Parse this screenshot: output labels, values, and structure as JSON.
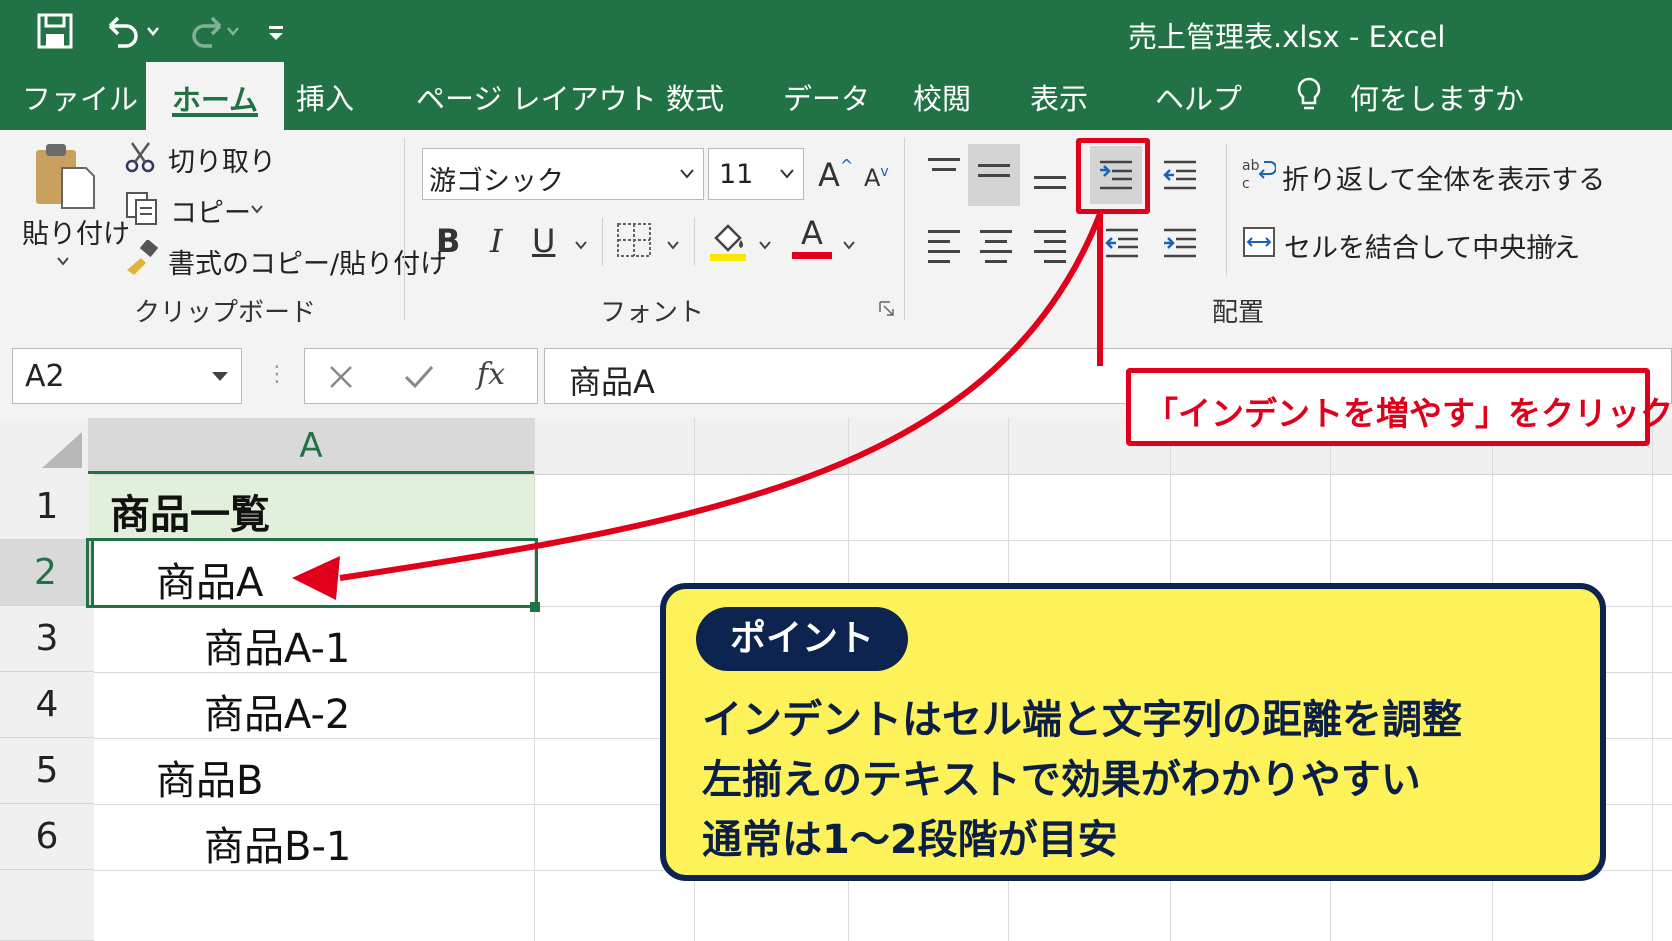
{
  "window": {
    "title": "売上管理表.xlsx  -  Excel"
  },
  "tabs": [
    "ファイル",
    "ホーム",
    "挿入",
    "ページ レイアウト",
    "数式",
    "データ",
    "校閲",
    "表示",
    "ヘルプ"
  ],
  "tell_me": "何をしますか",
  "clipboard": {
    "paste": "貼り付け",
    "cut": "切り取り",
    "copy": "コピー",
    "format_painter": "書式のコピー/貼り付け",
    "group_label": "クリップボード"
  },
  "font": {
    "name": "游ゴシック",
    "size": "11",
    "bold": "B",
    "italic": "I",
    "underline": "U",
    "font_color_letter": "A",
    "grow": "A",
    "shrink": "A",
    "group_label": "フォント",
    "highlight_color": "#f6e600",
    "font_color": "#e0001b"
  },
  "alignment": {
    "wrap_text": "折り返して全体を表示する",
    "merge_center": "セルを結合して中央揃え",
    "group_label": "配置"
  },
  "formula_bar": {
    "name_box": "A2",
    "fx": "fx",
    "content": "商品A"
  },
  "sheet": {
    "column_a_header": "A",
    "rows": [
      {
        "num": "1",
        "value": "商品一覧"
      },
      {
        "num": "2",
        "value": "商品A"
      },
      {
        "num": "3",
        "value": "商品A-1"
      },
      {
        "num": "4",
        "value": "商品A-2"
      },
      {
        "num": "5",
        "value": "商品B"
      },
      {
        "num": "6",
        "value": "商品B-1"
      }
    ]
  },
  "callout": {
    "label": "「インデントを増やす」をクリック",
    "color": "#e0001b"
  },
  "point": {
    "badge": "ポイント",
    "lines": [
      "インデントはセル端と文字列の距離を調整",
      "左揃えのテキストで効果がわかりやすい",
      "通常は1〜2段階が目安"
    ]
  },
  "colors": {
    "excel_green": "#217346",
    "point_bg": "#fdf25a",
    "point_border": "#0d2350"
  }
}
